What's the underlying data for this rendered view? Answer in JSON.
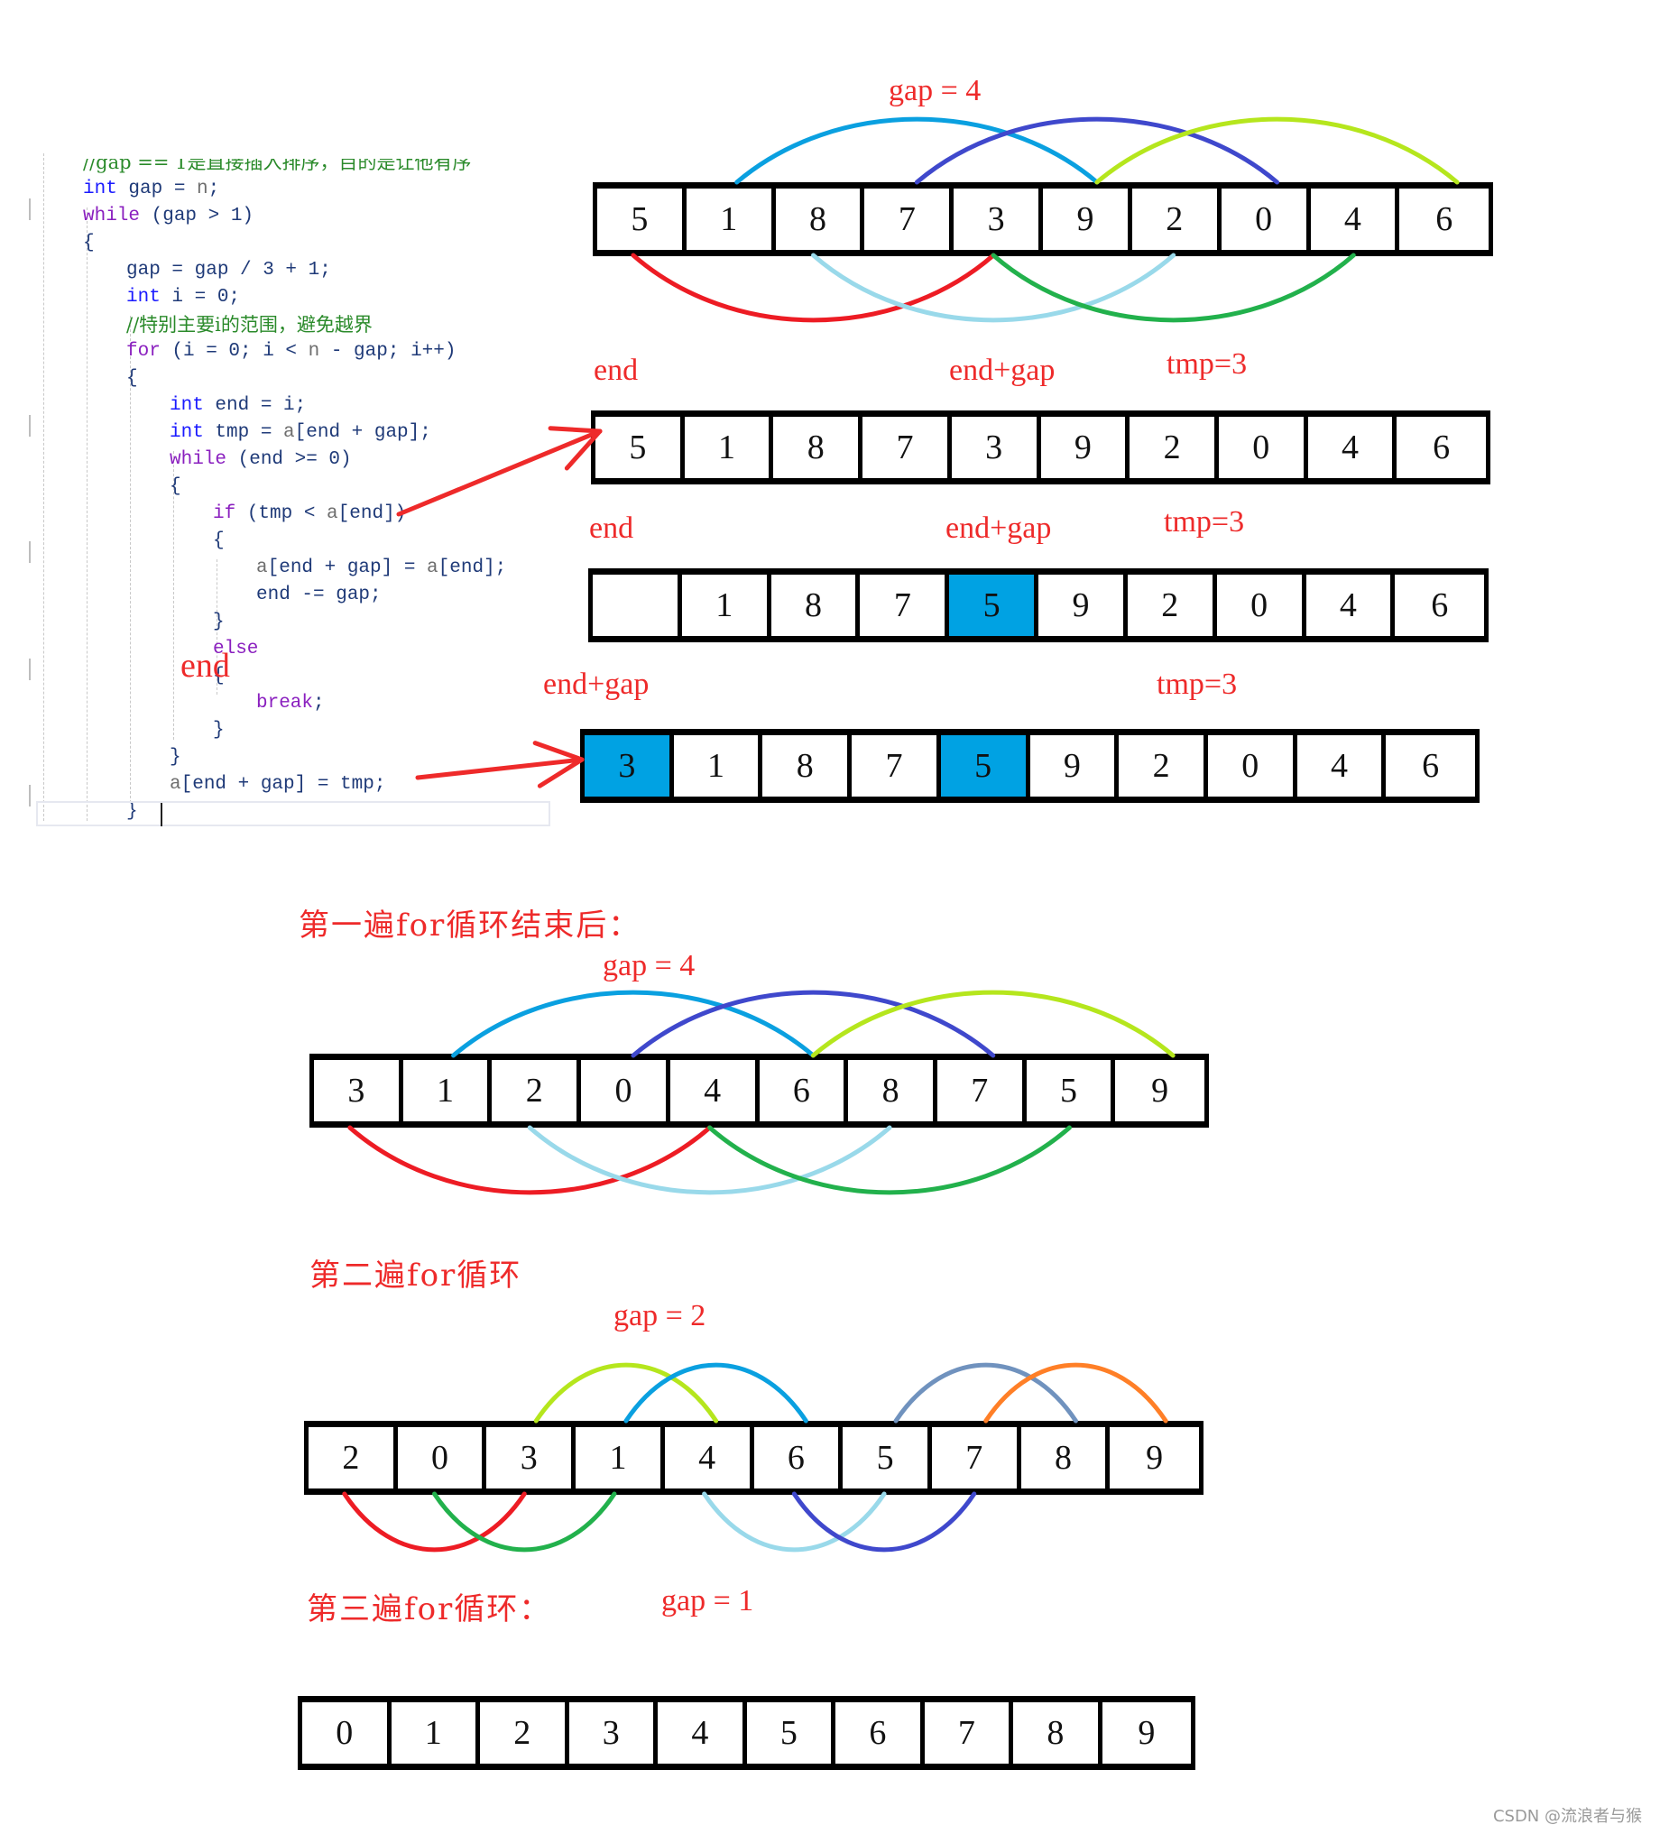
{
  "code": {
    "lines": [
      {
        "indent": 1,
        "parts": [
          {
            "t": "//gap == 1是直接插入排序，目的是让他有序",
            "c": "cmt"
          }
        ]
      },
      {
        "indent": 1,
        "parts": [
          {
            "t": "int",
            "c": "kw-blue"
          },
          {
            "t": " gap = ",
            "c": "var"
          },
          {
            "t": "n",
            "c": "gray"
          },
          {
            "t": ";",
            "c": "var"
          }
        ]
      },
      {
        "indent": 1,
        "parts": [
          {
            "t": "while",
            "c": "kw-purple"
          },
          {
            "t": " (gap > 1)",
            "c": "var"
          }
        ]
      },
      {
        "indent": 1,
        "parts": [
          {
            "t": "{",
            "c": "var"
          }
        ]
      },
      {
        "indent": 2,
        "parts": [
          {
            "t": "gap = gap / 3 + 1;",
            "c": "var"
          }
        ]
      },
      {
        "indent": 2,
        "parts": [
          {
            "t": "int",
            "c": "kw-blue"
          },
          {
            "t": " i = 0;",
            "c": "var"
          }
        ]
      },
      {
        "indent": 2,
        "parts": [
          {
            "t": "//特别主要i的范围，避免越界",
            "c": "cmt"
          }
        ]
      },
      {
        "indent": 2,
        "parts": [
          {
            "t": "for",
            "c": "kw-purple"
          },
          {
            "t": " (i = 0; i < ",
            "c": "var"
          },
          {
            "t": "n",
            "c": "gray"
          },
          {
            "t": " - gap; i++)",
            "c": "var"
          }
        ]
      },
      {
        "indent": 2,
        "parts": [
          {
            "t": "{",
            "c": "var"
          }
        ]
      },
      {
        "indent": 3,
        "parts": [
          {
            "t": "int",
            "c": "kw-blue"
          },
          {
            "t": " end = i;",
            "c": "var"
          }
        ]
      },
      {
        "indent": 3,
        "parts": [
          {
            "t": "int",
            "c": "kw-blue"
          },
          {
            "t": " tmp = ",
            "c": "var"
          },
          {
            "t": "a",
            "c": "gray"
          },
          {
            "t": "[end + gap];",
            "c": "var"
          }
        ]
      },
      {
        "indent": 3,
        "parts": [
          {
            "t": "while",
            "c": "kw-purple"
          },
          {
            "t": " (end >= 0)",
            "c": "var"
          }
        ]
      },
      {
        "indent": 3,
        "parts": [
          {
            "t": "{",
            "c": "var"
          }
        ]
      },
      {
        "indent": 4,
        "parts": [
          {
            "t": "if",
            "c": "kw-purple"
          },
          {
            "t": " (tmp < ",
            "c": "var"
          },
          {
            "t": "a",
            "c": "gray"
          },
          {
            "t": "[end])",
            "c": "var"
          }
        ]
      },
      {
        "indent": 4,
        "parts": [
          {
            "t": "{",
            "c": "var"
          }
        ]
      },
      {
        "indent": 5,
        "parts": [
          {
            "t": "a",
            "c": "gray"
          },
          {
            "t": "[end + gap] = ",
            "c": "var"
          },
          {
            "t": "a",
            "c": "gray"
          },
          {
            "t": "[end];",
            "c": "var"
          }
        ]
      },
      {
        "indent": 5,
        "parts": [
          {
            "t": "end -= gap;",
            "c": "var"
          }
        ]
      },
      {
        "indent": 4,
        "parts": [
          {
            "t": "}",
            "c": "var"
          }
        ]
      },
      {
        "indent": 4,
        "parts": [
          {
            "t": "else",
            "c": "kw-purple"
          }
        ]
      },
      {
        "indent": 4,
        "parts": [
          {
            "t": "{",
            "c": "var"
          }
        ]
      },
      {
        "indent": 5,
        "parts": [
          {
            "t": "break",
            "c": "kw-purple"
          },
          {
            "t": ";",
            "c": "var"
          }
        ]
      },
      {
        "indent": 4,
        "parts": [
          {
            "t": "}",
            "c": "var"
          }
        ]
      },
      {
        "indent": 3,
        "parts": [
          {
            "t": "}",
            "c": "var"
          }
        ]
      },
      {
        "indent": 3,
        "parts": [
          {
            "t": "a",
            "c": "gray"
          },
          {
            "t": "[end + gap] = tmp;",
            "c": "var"
          }
        ]
      },
      {
        "indent": 2,
        "parts": [
          {
            "t": "}",
            "c": "var"
          }
        ]
      }
    ],
    "overlay_label": "end"
  },
  "steps": {
    "initial": {
      "gap_label": "gap = 4",
      "values": [
        "5",
        "1",
        "8",
        "7",
        "3",
        "9",
        "2",
        "0",
        "4",
        "6"
      ]
    },
    "step_a": {
      "label_end": "end",
      "label_end_gap": "end+gap",
      "label_tmp": "tmp=3",
      "values": [
        "5",
        "1",
        "8",
        "7",
        "3",
        "9",
        "2",
        "0",
        "4",
        "6"
      ],
      "highlight": []
    },
    "step_b": {
      "label_end": "end",
      "label_end_gap": "end+gap",
      "label_tmp": "tmp=3",
      "values": [
        "",
        "1",
        "8",
        "7",
        "5",
        "9",
        "2",
        "0",
        "4",
        "6"
      ],
      "highlight": [
        4
      ]
    },
    "step_c": {
      "label_end_gap": "end+gap",
      "label_tmp": "tmp=3",
      "values": [
        "3",
        "1",
        "8",
        "7",
        "5",
        "9",
        "2",
        "0",
        "4",
        "6"
      ],
      "highlight": [
        0,
        4
      ]
    },
    "pass1": {
      "heading": "第一遍for循环结束后：",
      "gap_label": "gap = 4",
      "values": [
        "3",
        "1",
        "2",
        "0",
        "4",
        "6",
        "8",
        "7",
        "5",
        "9"
      ]
    },
    "pass2": {
      "heading": "第二遍for循环",
      "gap_label": "gap = 2",
      "values": [
        "2",
        "0",
        "3",
        "1",
        "4",
        "6",
        "5",
        "7",
        "8",
        "9"
      ]
    },
    "pass3": {
      "heading": "第三遍for循环：",
      "gap_label": "gap = 1",
      "values": [
        "0",
        "1",
        "2",
        "3",
        "4",
        "5",
        "6",
        "7",
        "8",
        "9"
      ]
    }
  },
  "colors": {
    "annotation_red": "#ee2a2a",
    "highlight_blue": "#00a2e3",
    "arc_sky": "#0aa0e0",
    "arc_indigo": "#3f48cc",
    "arc_lime": "#b5e61d",
    "arc_red": "#ed1c24",
    "arc_lightblue": "#99d9ea",
    "arc_green": "#22b14c",
    "arc_steel": "#7092be",
    "arc_orange": "#ff7f27"
  },
  "watermark": "CSDN @流浪者与猴"
}
